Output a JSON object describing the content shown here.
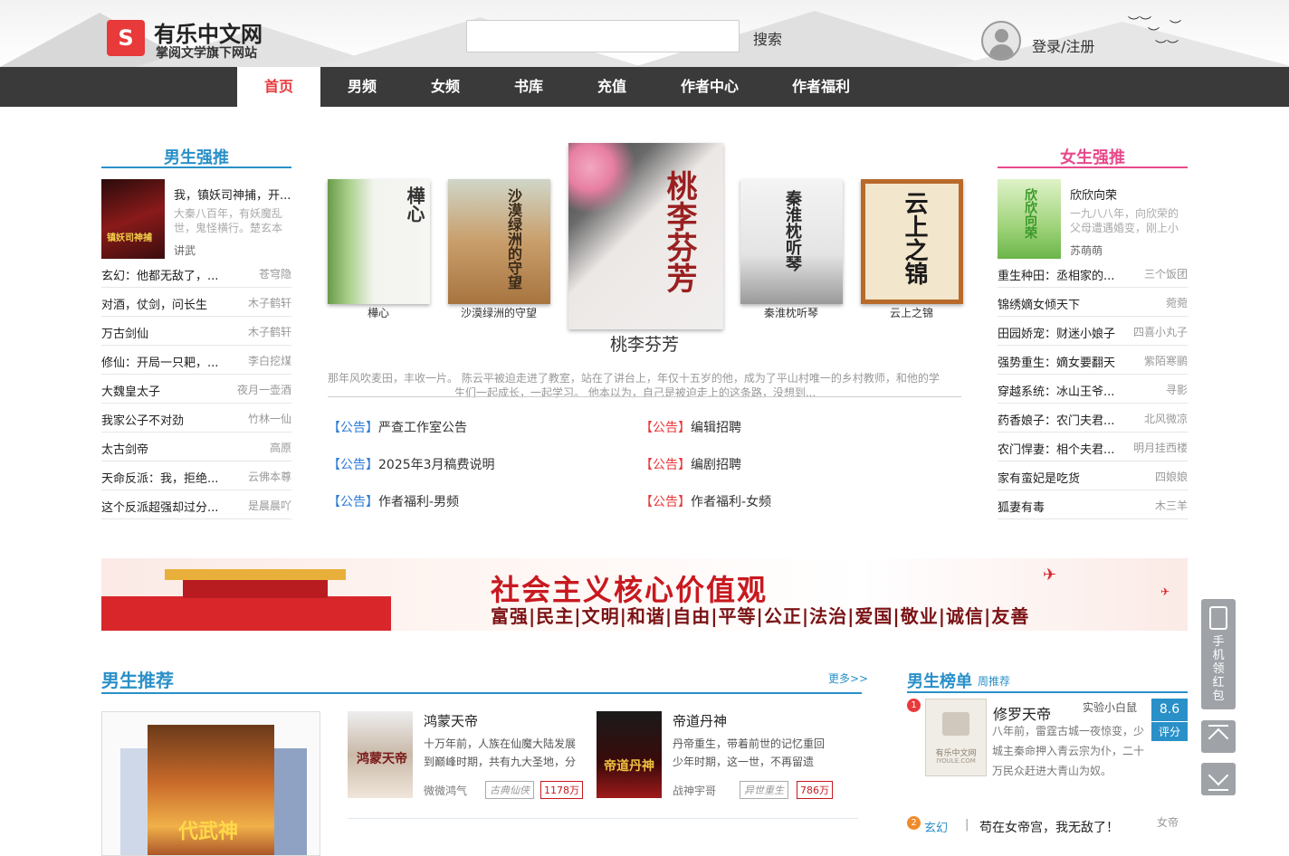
{
  "header": {
    "logo_title": "有乐中文网",
    "logo_subtitle": "掌阅文学旗下网站",
    "search_placeholder": "",
    "search_button": "搜索",
    "login_label": "登录/注册"
  },
  "nav": {
    "items": [
      "首页",
      "男频",
      "女频",
      "书库",
      "充值",
      "作者中心",
      "作者福利"
    ],
    "active": "首页"
  },
  "male_column": {
    "title": "男生强推",
    "featured": {
      "title": "我，镇妖司神捕，开...",
      "desc": "大秦八百年，有妖魔乱世，鬼怪横行。楚玄本",
      "author": "讲武"
    },
    "list": [
      {
        "title": "玄幻：他都无敌了，...",
        "author": "苍穹隐"
      },
      {
        "title": "对酒，仗剑，问长生",
        "author": "木子鹤轩"
      },
      {
        "title": "万古剑仙",
        "author": "木子鹤轩"
      },
      {
        "title": "修仙：开局一只耙，...",
        "author": "李白挖煤"
      },
      {
        "title": "大魏皇太子",
        "author": "夜月一壶酒"
      },
      {
        "title": "我家公子不对劲",
        "author": "竹林一仙"
      },
      {
        "title": "太古剑帝",
        "author": "高原"
      },
      {
        "title": "天命反派：我，拒绝...",
        "author": "云佛本尊"
      },
      {
        "title": "这个反派超强却过分...",
        "author": "是晨晨吖"
      }
    ]
  },
  "female_column": {
    "title": "女生强推",
    "featured": {
      "title": "欣欣向荣",
      "desc": "一九八八年，向欣荣的父母遭遇婚变，刚上小",
      "author": "苏萌萌"
    },
    "list": [
      {
        "title": "重生种田：丞相家的...",
        "author": "三个饭团"
      },
      {
        "title": "锦绣嫡女倾天下",
        "author": "菀菀"
      },
      {
        "title": "田园娇宠：财迷小娘子",
        "author": "四喜小丸子"
      },
      {
        "title": "强势重生：嫡女要翻天",
        "author": "紫陌寒鹂"
      },
      {
        "title": "穿越系统：冰山王爷...",
        "author": "寻影"
      },
      {
        "title": "药香娘子：农门夫君...",
        "author": "北风微凉"
      },
      {
        "title": "农门悍妻：相个夫君...",
        "author": "明月挂西楼"
      },
      {
        "title": "家有蛮妃是吃货",
        "author": "四娘娘"
      },
      {
        "title": "狐妻有毒",
        "author": "木三羊"
      }
    ]
  },
  "carousel": {
    "books": [
      {
        "label": "樺心",
        "cover_text": "樺心"
      },
      {
        "label": "沙漠绿洲的守望",
        "cover_text": "沙漠绿洲的守望"
      },
      {
        "label": "桃李芬芳",
        "cover_text": "桃李芬芳"
      },
      {
        "label": "秦淮枕听琴",
        "cover_text": "秦淮枕听琴"
      },
      {
        "label": "云上之锦",
        "cover_text": "云上之锦"
      }
    ],
    "active_title": "桃李芬芳",
    "desc_line1": "那年风吹麦田，丰收一片。        陈云平被迫走进了教室，站在了讲台上，年仅十五岁的他，成为了平山村唯一的乡村教师，和他的学",
    "desc_line2": "生们一起成长，一起学习。      他本以为，自己是被迫走上的这条路，没想到..."
  },
  "notices": [
    {
      "tag": "【公告】",
      "text": "严查工作室公告",
      "color": "blue"
    },
    {
      "tag": "【公告】",
      "text": "编辑招聘",
      "color": "red"
    },
    {
      "tag": "【公告】",
      "text": "2025年3月稿费说明",
      "color": "blue"
    },
    {
      "tag": "【公告】",
      "text": "编剧招聘",
      "color": "red"
    },
    {
      "tag": "【公告】",
      "text": "作者福利-男频",
      "color": "blue"
    },
    {
      "tag": "【公告】",
      "text": "作者福利-女频",
      "color": "red"
    }
  ],
  "banner": {
    "title": "社会主义核心价值观",
    "values": "富强|民主|文明|和谐|自由|平等|公正|法治|爱国|敬业|诚信|友善"
  },
  "recommend": {
    "title": "男生推荐",
    "more": "更多>>",
    "cover_frame_text": "代武神",
    "books": [
      {
        "name": "鸿蒙天帝",
        "desc": "十万年前，人族在仙魔大陆发展到巅峰时期，共有九大圣地，分",
        "author": "微微鸿气",
        "tag": "古典仙侠",
        "count": "1178万"
      },
      {
        "name": "帝道丹神",
        "desc": "丹帝重生，带着前世的记忆重回少年时期，这一世，不再留遗",
        "author": "战神宇哥",
        "tag": "异世重生",
        "count": "786万"
      }
    ]
  },
  "ranking": {
    "title": "男生榜单",
    "subtitle": "周推荐",
    "first": {
      "rank": "1",
      "name": "修罗天帝",
      "author": "实验小白鼠",
      "desc": "八年前，雷霆古城一夜惊变，少城主秦命押入青云宗为仆，二十万民众赶进大青山为奴。",
      "score": "8.6",
      "score_label": "评分",
      "cover_text": "有乐中文网",
      "cover_sub": "IYOULE.COM"
    },
    "second": {
      "rank": "2",
      "genre": "玄幻",
      "sep": "|",
      "name": "苟在女帝宫，我无敌了！",
      "author": "女帝"
    }
  },
  "float_bar": {
    "qr_label": "手机领红包"
  },
  "colors": {
    "accent_red": "#e8393b",
    "nav_bg": "#3a3a3a",
    "blue": "#2a90c8",
    "pink": "#e84a8c"
  }
}
